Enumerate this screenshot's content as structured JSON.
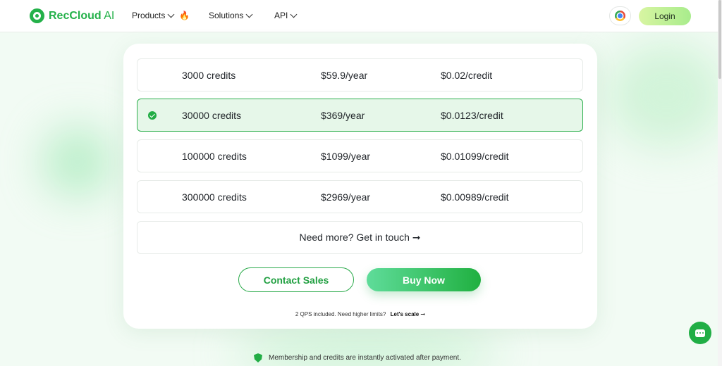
{
  "brand": {
    "name": "RecCloud",
    "suffix": " AI",
    "icon": "reccloud-logo-icon"
  },
  "nav": {
    "products": "Products",
    "solutions": "Solutions",
    "api": "API",
    "products_badge": "🔥"
  },
  "header": {
    "login": "Login",
    "browser_icon": "chrome-icon"
  },
  "plans": [
    {
      "credits": "3000 credits",
      "price": "$59.9/year",
      "unit": "$0.02/credit",
      "selected": false
    },
    {
      "credits": "30000 credits",
      "price": "$369/year",
      "unit": "$0.0123/credit",
      "selected": true
    },
    {
      "credits": "100000 credits",
      "price": "$1099/year",
      "unit": "$0.01099/credit",
      "selected": false
    },
    {
      "credits": "300000 credits",
      "price": "$2969/year",
      "unit": "$0.00989/credit",
      "selected": false
    }
  ],
  "contact_row": "Need more? Get in touch ➞",
  "buttons": {
    "contact_sales": "Contact Sales",
    "buy_now": "Buy Now"
  },
  "qps": {
    "text": "2 QPS included. Need higher limits?",
    "link": "Let's scale ➞"
  },
  "activation_note": "Membership and credits are instantly activated after payment.",
  "colors": {
    "accent": "#24b14a",
    "selected_bg": "#e6f7e9"
  }
}
